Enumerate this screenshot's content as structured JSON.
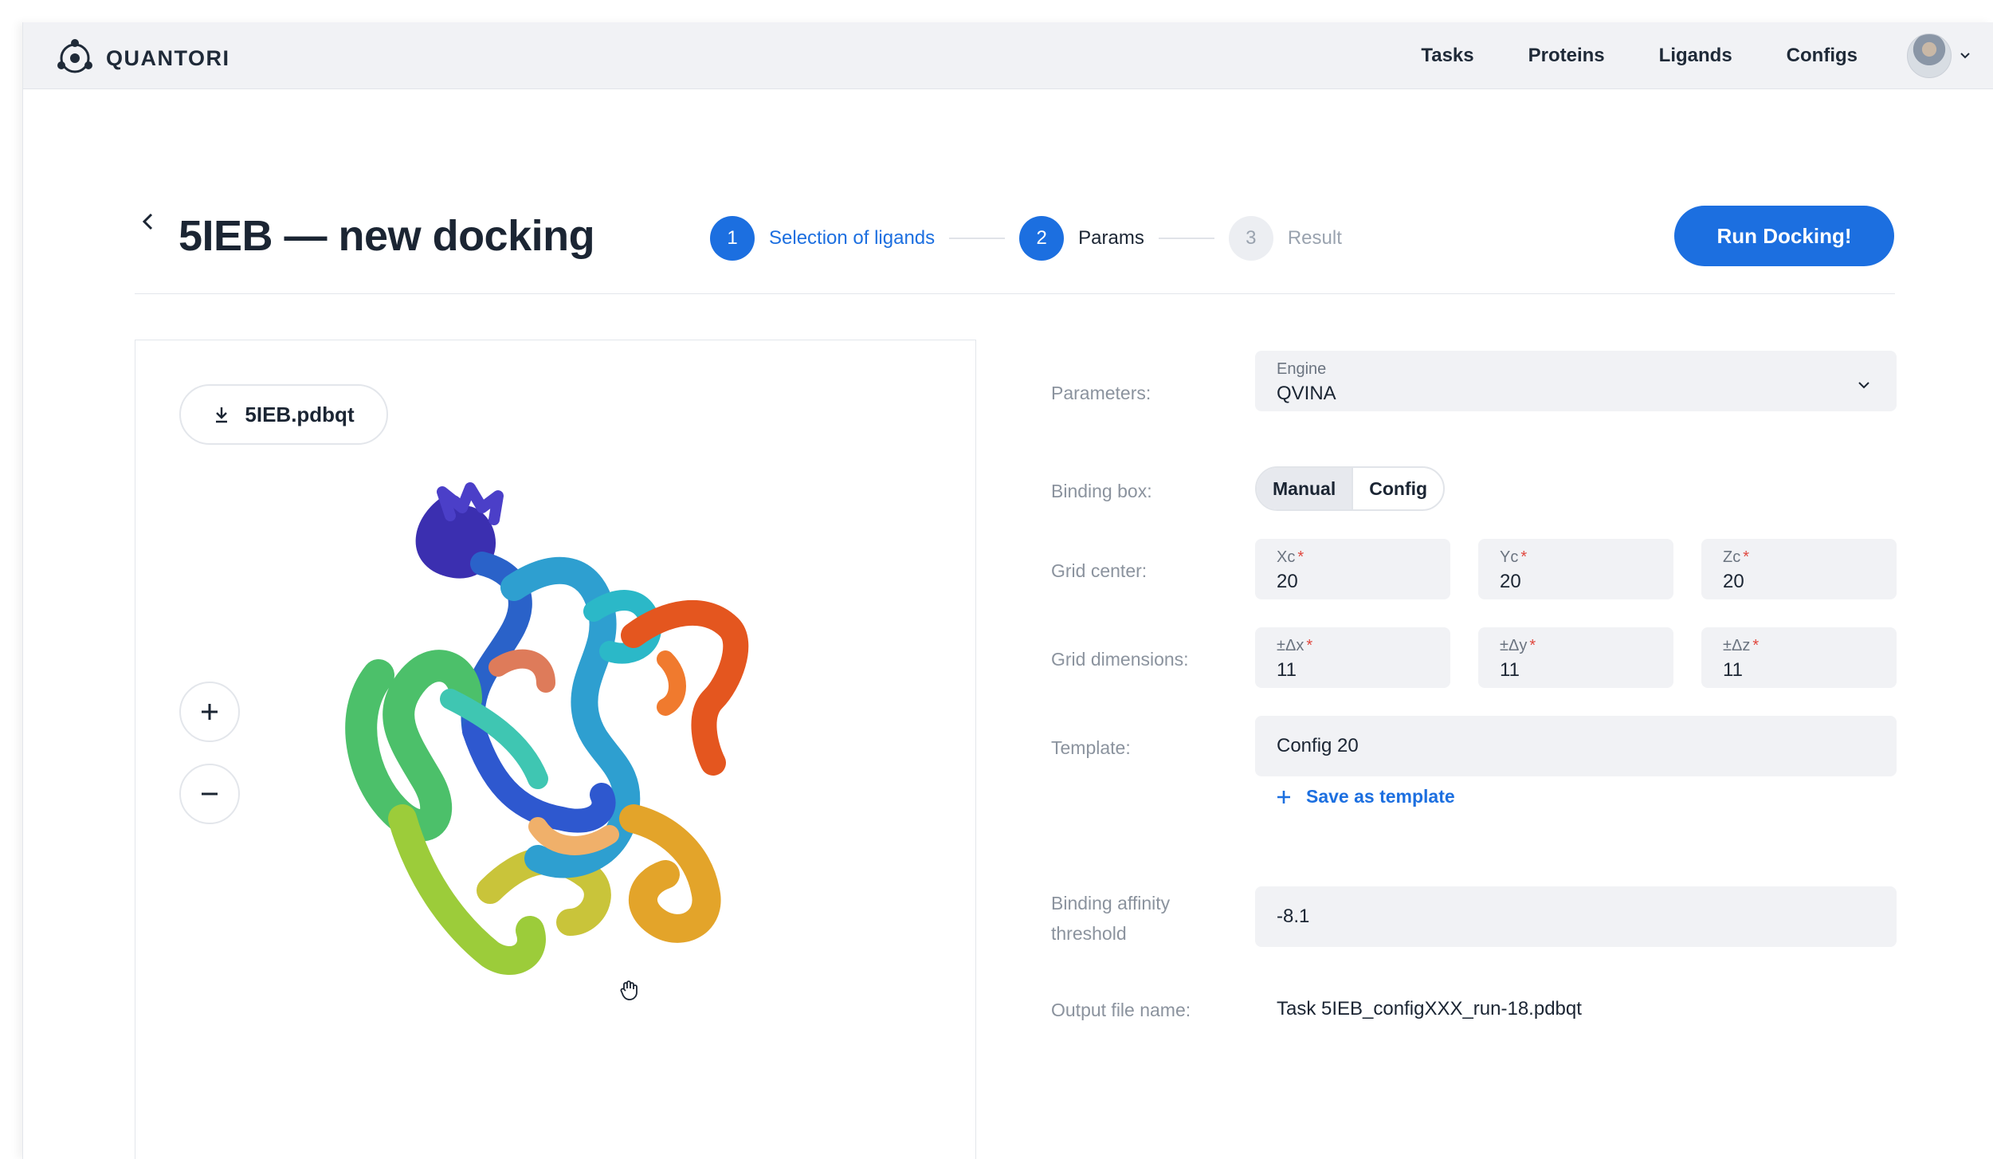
{
  "app": {
    "brand": "QUANTORI",
    "nav": [
      "Tasks",
      "Proteins",
      "Ligands",
      "Configs"
    ]
  },
  "header": {
    "title": "5IEB — new docking",
    "steps": [
      {
        "num": "1",
        "label": "Selection of ligands",
        "state": "done"
      },
      {
        "num": "2",
        "label": "Params",
        "state": "active"
      },
      {
        "num": "3",
        "label": "Result",
        "state": "todo"
      }
    ],
    "run_label": "Run Docking!"
  },
  "viewer": {
    "file_label": "5IEB.pdbqt",
    "zoom_in": "+",
    "zoom_out": "−"
  },
  "form": {
    "parameters_label": "Parameters:",
    "engine_caption": "Engine",
    "engine_value": "QVINA",
    "binding_box_label": "Binding box:",
    "binding_box_options": [
      "Manual",
      "Config"
    ],
    "grid_center_label": "Grid center:",
    "grid_center": [
      {
        "caption": "Xc",
        "value": "20"
      },
      {
        "caption": "Yc",
        "value": "20"
      },
      {
        "caption": "Zc",
        "value": "20"
      }
    ],
    "grid_dim_label": "Grid dimensions:",
    "grid_dim": [
      {
        "caption": "±Δx",
        "value": "11"
      },
      {
        "caption": "±Δy",
        "value": "11"
      },
      {
        "caption": "±Δz",
        "value": "11"
      }
    ],
    "template_label": "Template:",
    "template_value": "Config 20",
    "save_template_label": "Save as template",
    "affinity_label_1": "Binding affinity",
    "affinity_label_2": "threshold",
    "affinity_value": "-8.1",
    "output_label": "Output file name:",
    "output_value": "Task 5IEB_configXXX_run-18.pdbqt"
  },
  "colors": {
    "accent": "#1c6fe0",
    "required": "#e0483f"
  }
}
